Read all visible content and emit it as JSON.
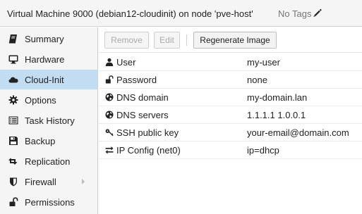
{
  "header": {
    "title": "Virtual Machine 9000 (debian12-cloudinit) on node 'pve-host'",
    "tags_label": "No Tags",
    "tags_icon": "pencil-icon"
  },
  "sidebar": {
    "items": [
      {
        "label": "Summary",
        "icon": "book-icon",
        "active": false
      },
      {
        "label": "Hardware",
        "icon": "monitor-icon",
        "active": false
      },
      {
        "label": "Cloud-Init",
        "icon": "cloud-icon",
        "active": true
      },
      {
        "label": "Options",
        "icon": "gear-icon",
        "active": false
      },
      {
        "label": "Task History",
        "icon": "list-icon",
        "active": false
      },
      {
        "label": "Backup",
        "icon": "floppy-icon",
        "active": false
      },
      {
        "label": "Replication",
        "icon": "retweet-icon",
        "active": false
      },
      {
        "label": "Firewall",
        "icon": "shield-icon",
        "active": false,
        "has_submenu": true
      },
      {
        "label": "Permissions",
        "icon": "unlock-icon",
        "active": false
      }
    ]
  },
  "toolbar": {
    "remove_label": "Remove",
    "edit_label": "Edit",
    "regenerate_label": "Regenerate Image"
  },
  "cloudinit": {
    "rows": [
      {
        "key": "User",
        "value": "my-user",
        "icon": "user-icon"
      },
      {
        "key": "Password",
        "value": "none",
        "icon": "unlock-icon"
      },
      {
        "key": "DNS domain",
        "value": "my-domain.lan",
        "icon": "globe-icon"
      },
      {
        "key": "DNS servers",
        "value": "1.1.1.1 1.0.0.1",
        "icon": "globe-icon"
      },
      {
        "key": "SSH public key",
        "value": "your-email@domain.com",
        "icon": "key-icon"
      },
      {
        "key": "IP Config (net0)",
        "value": "ip=dhcp",
        "icon": "exchange-icon"
      }
    ]
  },
  "colors": {
    "active_nav_bg": "#c2dcf1",
    "sidebar_bg": "#f5f5f5",
    "border": "#cfcfcf"
  }
}
